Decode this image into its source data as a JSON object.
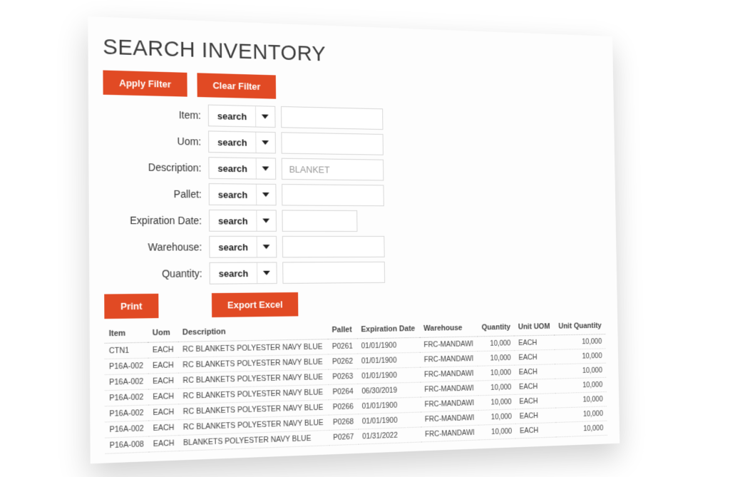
{
  "title": "SEARCH INVENTORY",
  "buttons": {
    "apply_filter": "Apply Filter",
    "clear_filter": "Clear Filter",
    "print": "Print",
    "export_excel": "Export Excel"
  },
  "select_default": "search",
  "filters": {
    "item": {
      "label": "Item:",
      "value": ""
    },
    "uom": {
      "label": "Uom:",
      "value": ""
    },
    "description": {
      "label": "Description:",
      "value": "BLANKET"
    },
    "pallet": {
      "label": "Pallet:",
      "value": ""
    },
    "expdate": {
      "label": "Expiration Date:",
      "value": ""
    },
    "warehouse": {
      "label": "Warehouse:",
      "value": ""
    },
    "quantity": {
      "label": "Quantity:",
      "value": ""
    }
  },
  "table": {
    "headers": {
      "item": "Item",
      "uom": "Uom",
      "description": "Description",
      "pallet": "Pallet",
      "expdate": "Expiration Date",
      "warehouse": "Warehouse",
      "quantity": "Quantity",
      "unit_uom": "Unit UOM",
      "unit_quantity": "Unit Quantity"
    },
    "rows": [
      {
        "item": "CTN1",
        "uom": "EACH",
        "description": "RC BLANKETS POLYESTER NAVY BLUE",
        "pallet": "P0261",
        "expdate": "01/01/1900",
        "warehouse": "FRC-MANDAWI",
        "quantity": "10,000",
        "unit_uom": "EACH",
        "unit_quantity": "10,000"
      },
      {
        "item": "P16A-002",
        "uom": "EACH",
        "description": "RC BLANKETS POLYESTER NAVY BLUE",
        "pallet": "P0262",
        "expdate": "01/01/1900",
        "warehouse": "FRC-MANDAWI",
        "quantity": "10,000",
        "unit_uom": "EACH",
        "unit_quantity": "10,000"
      },
      {
        "item": "P16A-002",
        "uom": "EACH",
        "description": "RC BLANKETS POLYESTER NAVY BLUE",
        "pallet": "P0263",
        "expdate": "01/01/1900",
        "warehouse": "FRC-MANDAWI",
        "quantity": "10,000",
        "unit_uom": "EACH",
        "unit_quantity": "10,000"
      },
      {
        "item": "P16A-002",
        "uom": "EACH",
        "description": "RC BLANKETS POLYESTER NAVY BLUE",
        "pallet": "P0264",
        "expdate": "06/30/2019",
        "warehouse": "FRC-MANDAWI",
        "quantity": "10,000",
        "unit_uom": "EACH",
        "unit_quantity": "10,000"
      },
      {
        "item": "P16A-002",
        "uom": "EACH",
        "description": "RC BLANKETS POLYESTER NAVY BLUE",
        "pallet": "P0266",
        "expdate": "01/01/1900",
        "warehouse": "FRC-MANDAWI",
        "quantity": "10,000",
        "unit_uom": "EACH",
        "unit_quantity": "10,000"
      },
      {
        "item": "P16A-002",
        "uom": "EACH",
        "description": "RC BLANKETS POLYESTER NAVY BLUE",
        "pallet": "P0268",
        "expdate": "01/01/1900",
        "warehouse": "FRC-MANDAWI",
        "quantity": "10,000",
        "unit_uom": "EACH",
        "unit_quantity": "10,000"
      },
      {
        "item": "P16A-008",
        "uom": "EACH",
        "description": "BLANKETS POLYESTER NAVY BLUE",
        "pallet": "P0267",
        "expdate": "01/31/2022",
        "warehouse": "FRC-MANDAWI",
        "quantity": "10,000",
        "unit_uom": "EACH",
        "unit_quantity": "10,000"
      }
    ]
  }
}
